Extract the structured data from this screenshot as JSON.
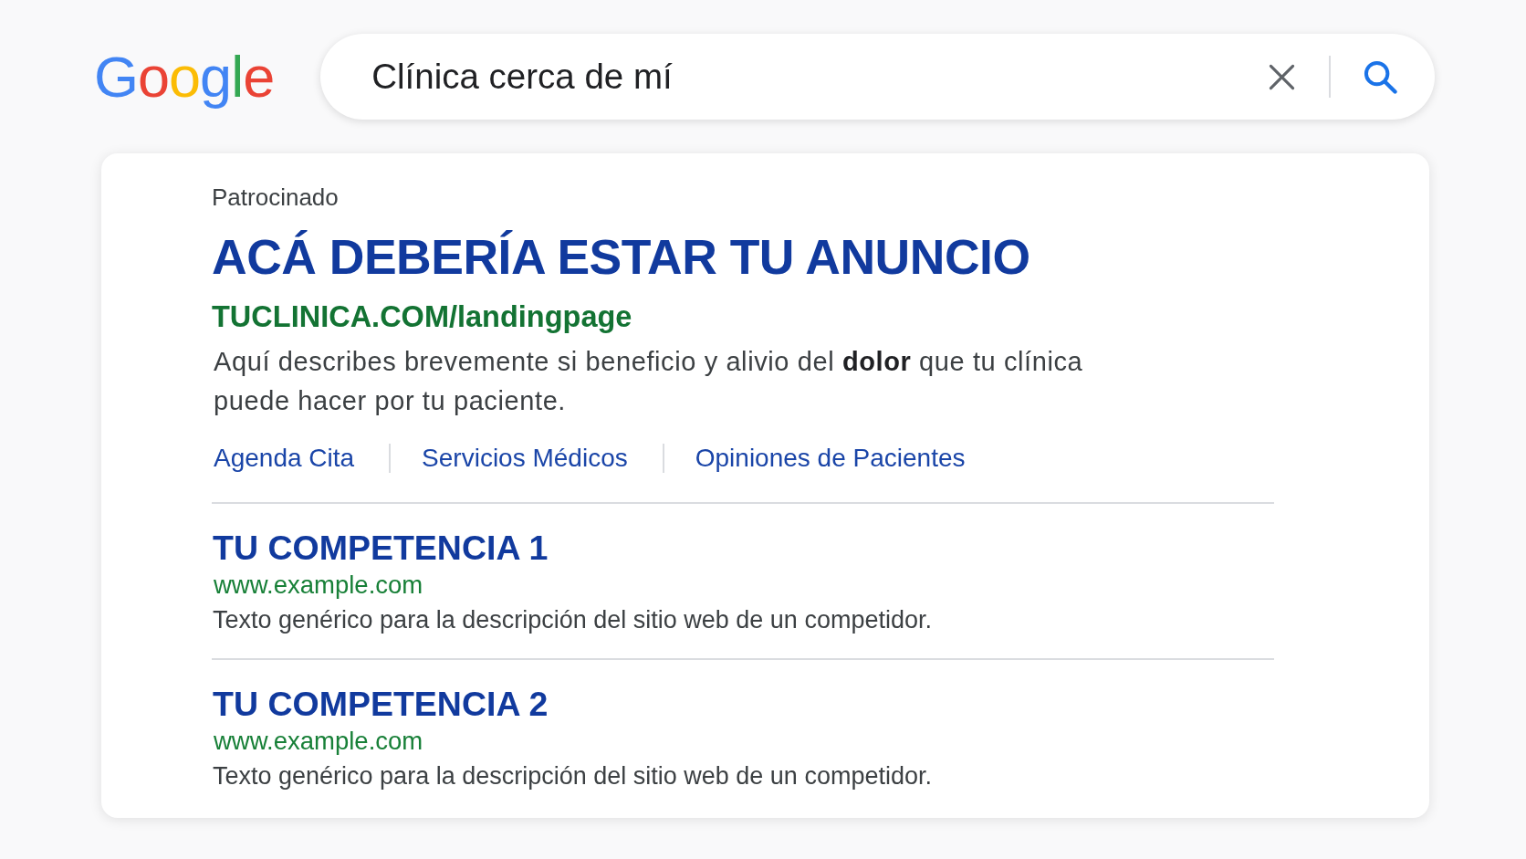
{
  "logo": {
    "letters": [
      {
        "char": "G",
        "color": "#4285f4"
      },
      {
        "char": "o",
        "color": "#ea4335"
      },
      {
        "char": "o",
        "color": "#fbbc05"
      },
      {
        "char": "g",
        "color": "#4285f4"
      },
      {
        "char": "l",
        "color": "#34a853"
      },
      {
        "char": "e",
        "color": "#ea4335"
      }
    ]
  },
  "search": {
    "value": "Clínica cerca de mí"
  },
  "ad": {
    "label": "Patrocinado",
    "title": "ACÁ DEBERÍA ESTAR TU ANUNCIO",
    "url": "TUCLINICA.COM/landingpage",
    "description": "Aquí describes brevemente si beneficio y alivio del **dolor** que tu clínica puede hacer por tu paciente.",
    "sitelinks": [
      "Agenda Cita",
      "Servicios Médicos",
      "Opiniones de Pacientes"
    ]
  },
  "results": [
    {
      "title": "TU COMPETENCIA 1",
      "url": "www.example.com",
      "description": "Texto genérico para la descripción del sitio web de un competidor."
    },
    {
      "title": "TU COMPETENCIA 2",
      "url": "www.example.com",
      "description": "Texto genérico para la descripción del sitio web de un competidor."
    }
  ]
}
